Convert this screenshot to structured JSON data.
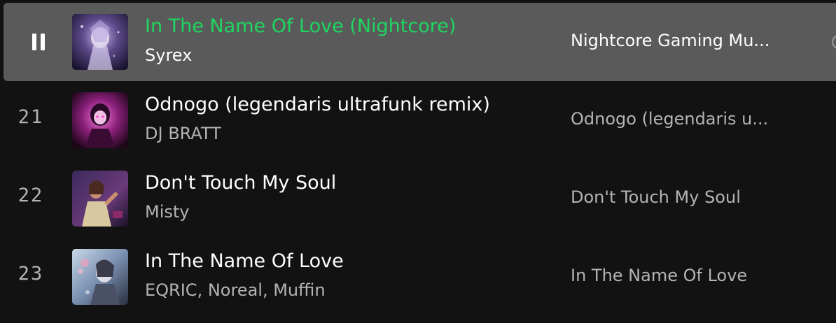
{
  "tracks": [
    {
      "index": "",
      "state": "playing",
      "title": "In The Name Of Love (Nightcore)",
      "artist": "Syrex",
      "album": "Nightcore Gaming Mu..."
    },
    {
      "index": "21",
      "state": "idle",
      "title": "Odnogo (legendaris ultrafunk remix)",
      "artist": "DJ BRATT",
      "album": "Odnogo (legendaris u..."
    },
    {
      "index": "22",
      "state": "idle",
      "title": "Don't Touch My Soul",
      "artist": "Misty",
      "album": "Don't Touch My Soul"
    },
    {
      "index": "23",
      "state": "idle",
      "title": "In The Name Of Love",
      "artist": "EQRIC, Noreal, Muffin",
      "album": "In The Name Of Love"
    }
  ],
  "icons": {
    "now_playing_control": "pause-icon",
    "row_edge_control": "add-circle-icon"
  },
  "colors": {
    "background": "#121212",
    "active_row": "#5a5a5a",
    "playing_title": "#1ed760",
    "secondary_text": "#b3b3b3",
    "primary_text": "#ffffff"
  }
}
